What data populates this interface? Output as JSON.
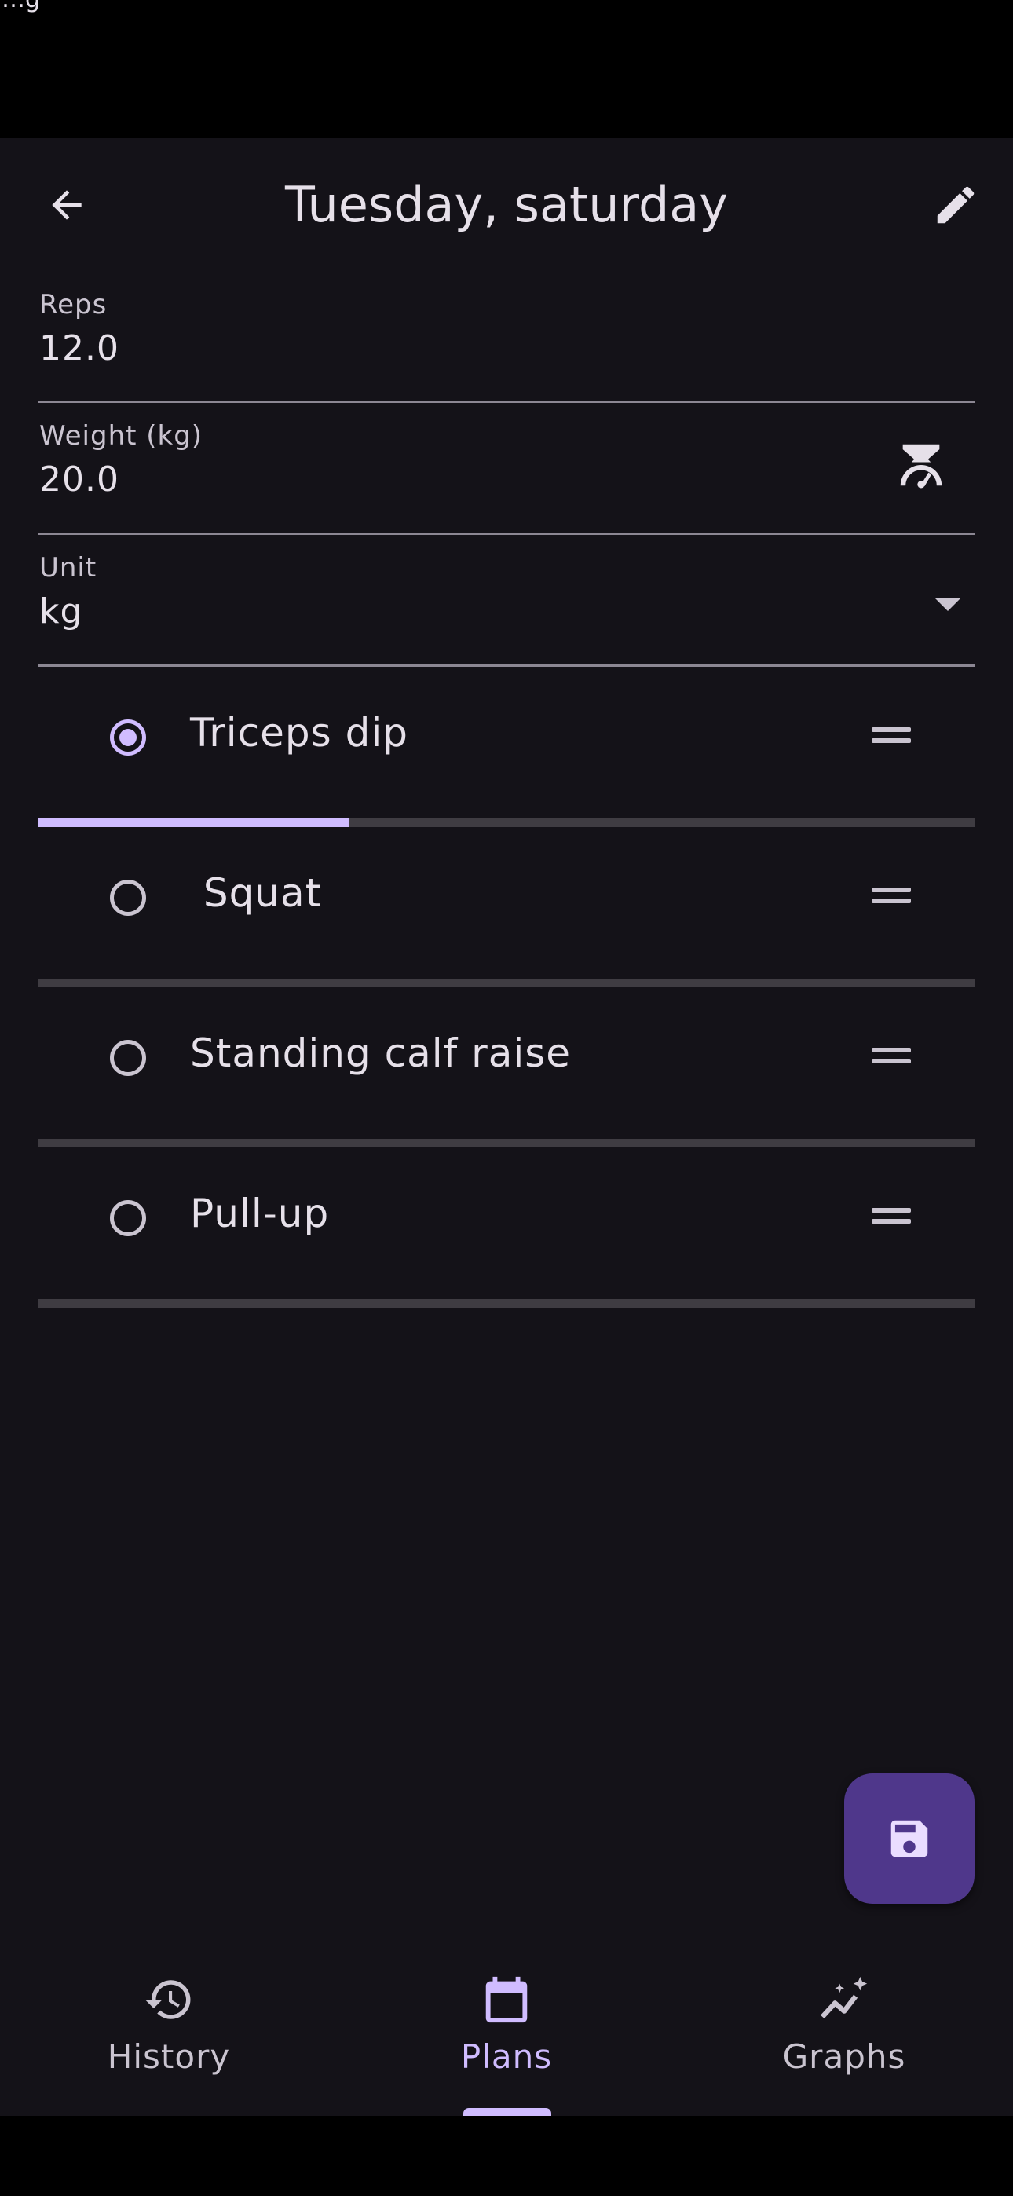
{
  "status_bar": {
    "text": "…g"
  },
  "app_bar": {
    "title": "Tuesday, saturday",
    "back_icon": "arrow-back-icon",
    "edit_icon": "pencil-icon"
  },
  "fields": {
    "reps": {
      "label": "Reps",
      "value": "12.0"
    },
    "weight": {
      "label": "Weight (kg)",
      "value": "20.0",
      "icon": "scale-icon"
    },
    "unit": {
      "label": "Unit",
      "value": "kg"
    }
  },
  "exercises": [
    {
      "name": "Triceps dip",
      "selected": true,
      "progress": 0.33
    },
    {
      "name": " Squat",
      "selected": false,
      "progress": 0
    },
    {
      "name": "Standing calf raise",
      "selected": false,
      "progress": 0
    },
    {
      "name": "Pull-up",
      "selected": false,
      "progress": 0
    }
  ],
  "fab": {
    "icon": "save-icon"
  },
  "nav": {
    "items": [
      {
        "label": "History",
        "icon": "history-icon",
        "active": false
      },
      {
        "label": "Plans",
        "icon": "calendar-icon",
        "active": true
      },
      {
        "label": "Graphs",
        "icon": "graph-icon",
        "active": false
      }
    ]
  },
  "colors": {
    "background": "#141218",
    "accent": "#d0bcff",
    "fab": "#4f378b",
    "text": "#e6e0e9"
  }
}
